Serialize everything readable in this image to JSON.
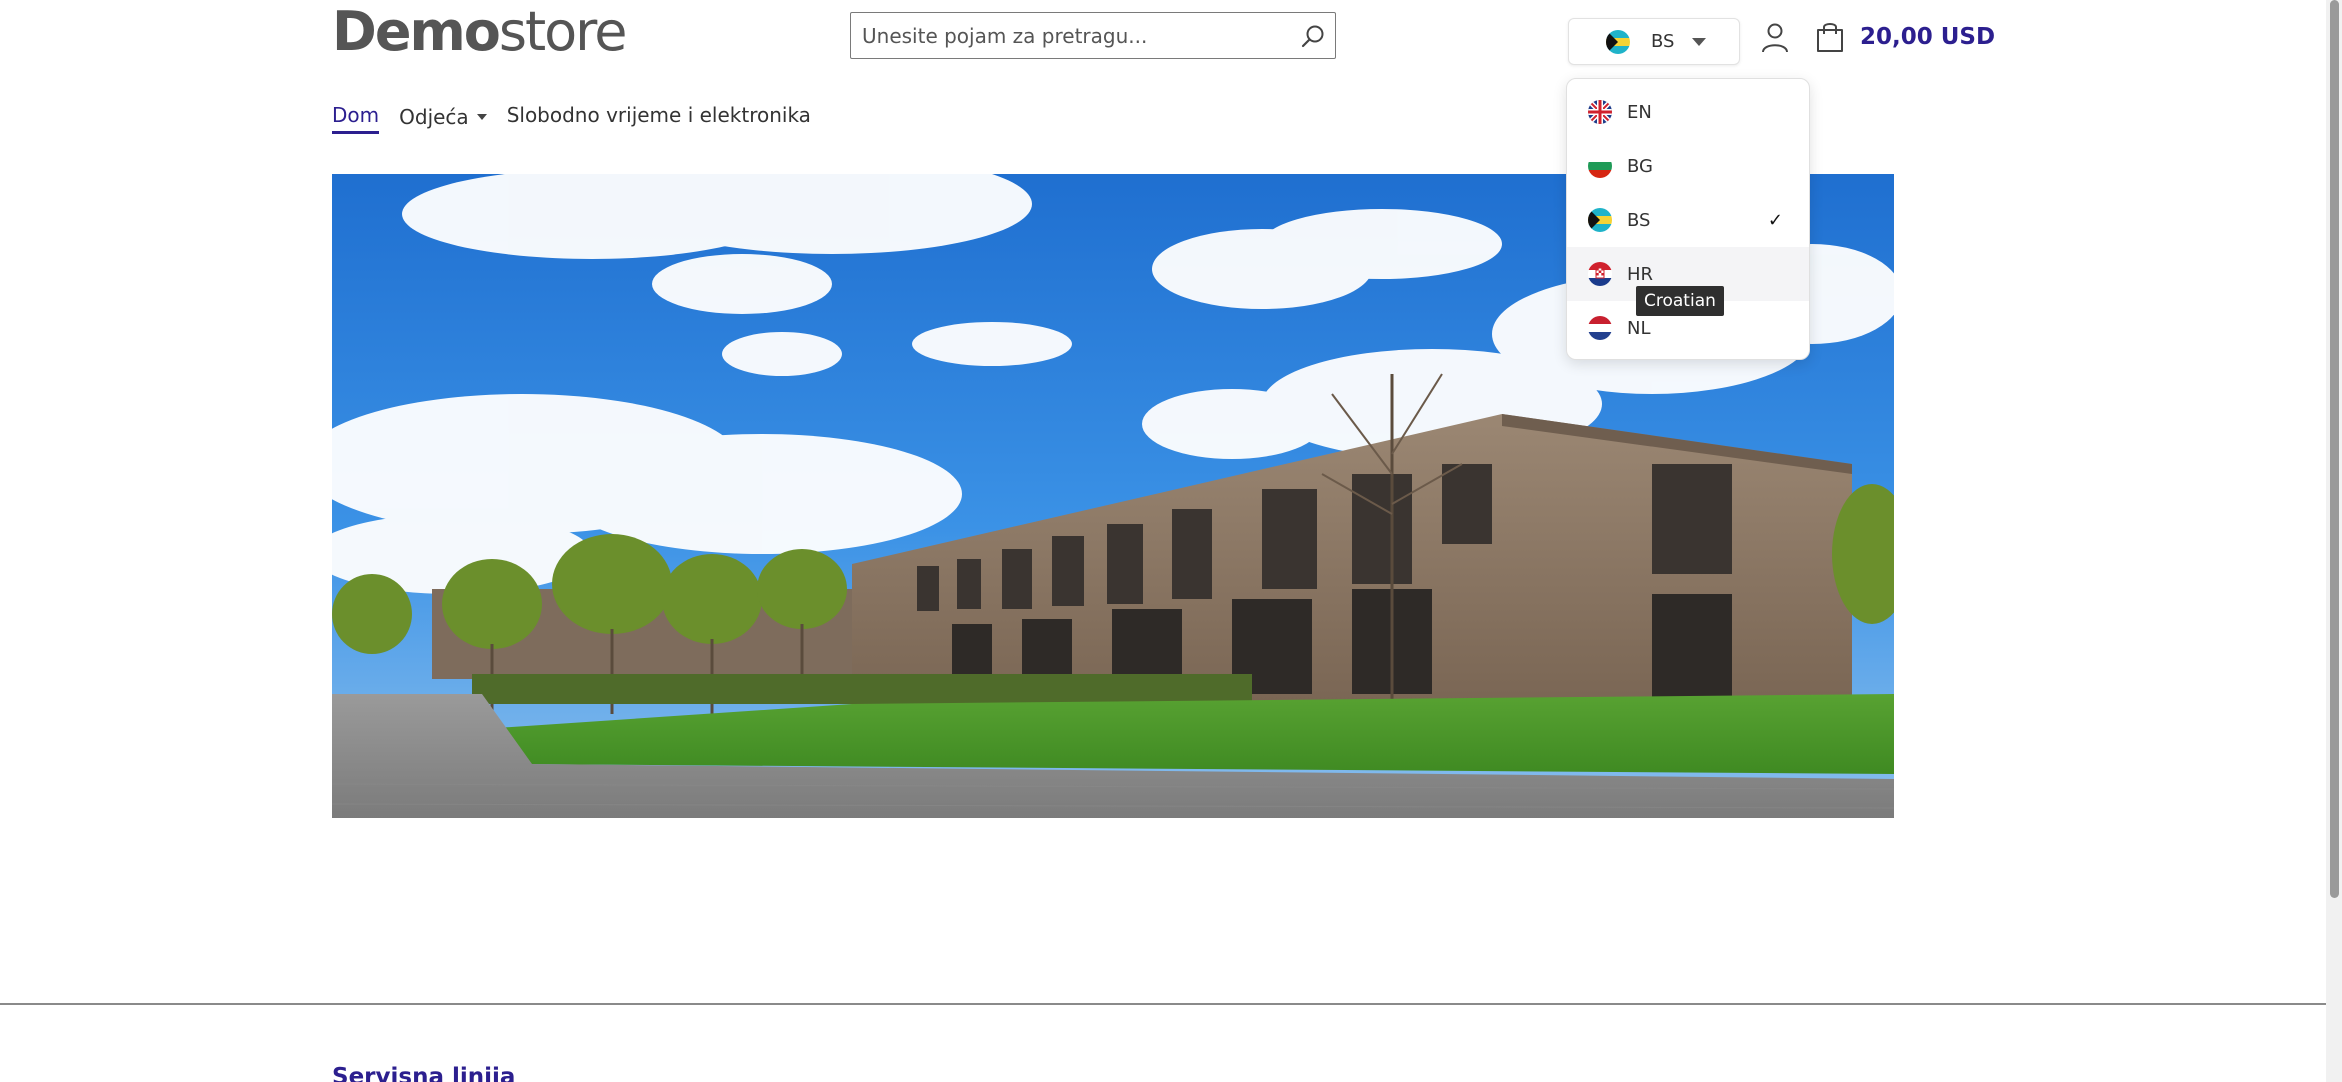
{
  "header": {
    "logo_bold": "Demo",
    "logo_light": "store",
    "search_placeholder": "Unesite pojam za pretragu...",
    "language_current": "BS",
    "cart_total": "20,00 USD"
  },
  "nav": {
    "items": [
      {
        "label": "Dom"
      },
      {
        "label": "Odjeća"
      },
      {
        "label": "Slobodno vrijeme i elektronika"
      }
    ]
  },
  "language_menu": {
    "options": [
      {
        "code": "EN",
        "flag": "uk-flag-icon"
      },
      {
        "code": "BG",
        "flag": "bulgaria-flag-icon"
      },
      {
        "code": "BS",
        "flag": "bahamas-flag-icon",
        "selected": true
      },
      {
        "code": "HR",
        "flag": "croatia-flag-icon"
      },
      {
        "code": "NL",
        "flag": "netherlands-flag-icon"
      }
    ],
    "selected_mark": "✓",
    "tooltip": "Croatian"
  },
  "footer": {
    "heading": "Servisna linija"
  },
  "colors": {
    "brand": "#2c1f8f",
    "text": "#333333",
    "divider": "#8a8a8a"
  }
}
